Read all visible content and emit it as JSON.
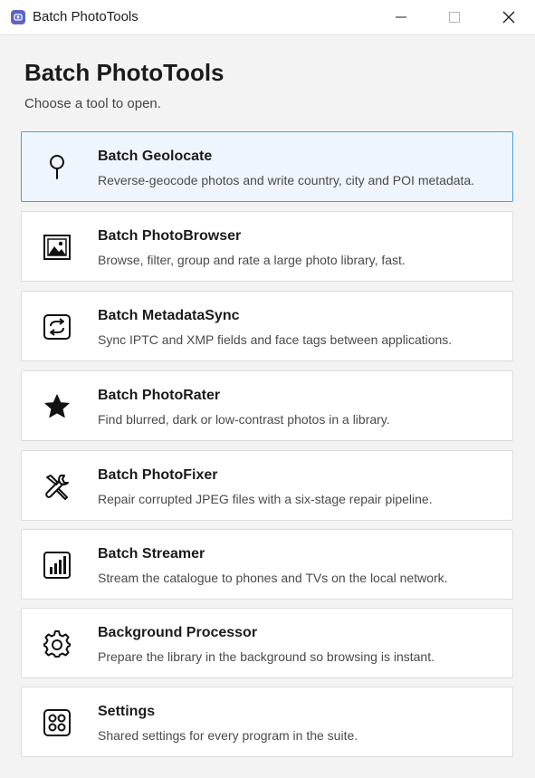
{
  "window": {
    "title": "Batch PhotoTools",
    "controls": {
      "minimize": "minimize-icon",
      "maximize": "maximize-icon",
      "close": "close-icon"
    }
  },
  "main": {
    "heading": "Batch PhotoTools",
    "subheading": "Choose a tool to open.",
    "tools": [
      {
        "title": "Batch Geolocate",
        "description": "Reverse-geocode photos and write country, city and POI metadata.",
        "icon": "map-pin-icon",
        "selected": true
      },
      {
        "title": "Batch PhotoBrowser",
        "description": "Browse, filter, group and rate a large photo library, fast.",
        "icon": "photo-icon",
        "selected": false
      },
      {
        "title": "Batch MetadataSync",
        "description": "Sync IPTC and XMP fields and face tags between applications.",
        "icon": "sync-icon",
        "selected": false
      },
      {
        "title": "Batch PhotoRater",
        "description": "Find blurred, dark or low-contrast photos in a library.",
        "icon": "star-icon",
        "selected": false
      },
      {
        "title": "Batch PhotoFixer",
        "description": "Repair corrupted JPEG files with a six-stage repair pipeline.",
        "icon": "tools-icon",
        "selected": false
      },
      {
        "title": "Batch Streamer",
        "description": "Stream the catalogue to phones and TVs on the local network.",
        "icon": "signal-bars-icon",
        "selected": false
      },
      {
        "title": "Background Processor",
        "description": "Prepare the library in the background so browsing is instant.",
        "icon": "gear-icon",
        "selected": false
      },
      {
        "title": "Settings",
        "description": "Shared settings for every program in the suite.",
        "icon": "settings-panel-icon",
        "selected": false
      }
    ]
  },
  "colors": {
    "accent": "#4ba0df",
    "selected_background": "#eef5fc",
    "card_background": "#ffffff",
    "window_background": "#f3f3f3",
    "app_icon": "#5b63c9"
  }
}
